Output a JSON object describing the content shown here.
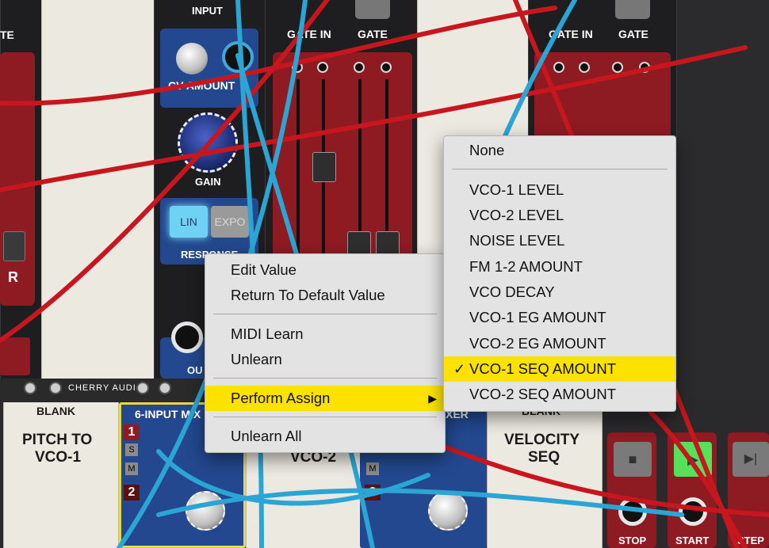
{
  "modules": {
    "top_labels": {
      "gate_left": "TE",
      "input": "INPUT",
      "gate_in_1": "GATE IN",
      "gate_1": "GATE",
      "gate_in_2": "GATE IN",
      "gate_2": "GATE"
    },
    "cv_amount": "CV AMOUNT",
    "gain": "GAIN",
    "response": "RESPONSE",
    "lin": "LIN",
    "expo": "EXPO",
    "r_label": "R",
    "brand": "CHERRY AUDIO",
    "out_label": "OU",
    "blank_1": "BLANK",
    "pitch_to": "PITCH TO",
    "vco1": "VCO-1",
    "mixer_title": "6-INPUT MIX",
    "mixer_title_2": "XER",
    "vco2_partial": "VCO-2",
    "blank_2": "BLANK",
    "velocity": "VELOCITY",
    "seq": "SEQ",
    "ch1": "1",
    "ch2": "2",
    "s": "S",
    "m": "M",
    "stop": "STOP",
    "start": "START",
    "step": "STEP"
  },
  "context_menu": {
    "items": [
      "Edit Value",
      "Return To Default Value",
      "MIDI Learn",
      "Unlearn",
      "Perform Assign",
      "Unlearn All"
    ],
    "submenu_arrow": "▶"
  },
  "submenu": {
    "none": "None",
    "items": [
      "VCO-1 LEVEL",
      "VCO-2 LEVEL",
      "NOISE LEVEL",
      "FM 1-2 AMOUNT",
      "VCO DECAY",
      "VCO-1 EG AMOUNT",
      "VCO-2 EG AMOUNT",
      "VCO-1 SEQ AMOUNT",
      "VCO-2 SEQ AMOUNT"
    ],
    "checked_index": 7,
    "checkmark": "✓"
  },
  "colors": {
    "highlight": "#fde200",
    "cable_red": "#c8161e",
    "cable_blue": "#2aa5d4",
    "module_red": "#8e1a22",
    "panel_blue": "#23488f"
  }
}
